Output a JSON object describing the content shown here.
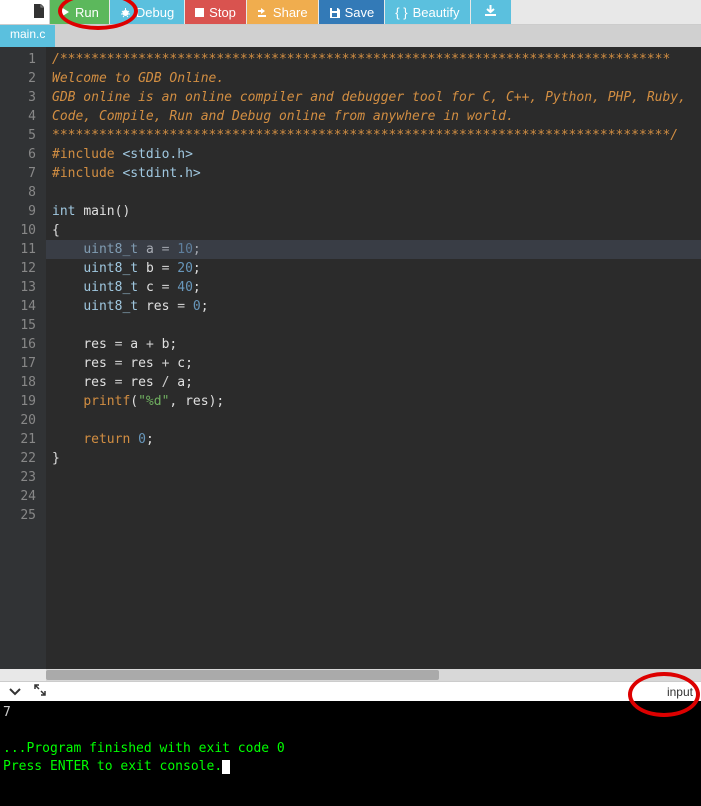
{
  "toolbar": {
    "run": "Run",
    "debug": "Debug",
    "stop": "Stop",
    "share": "Share",
    "save": "Save",
    "beautify": "Beautify"
  },
  "tabs": {
    "active": "main.c"
  },
  "code": {
    "lines": [
      {
        "n": 1,
        "t": "comment",
        "text": "/******************************************************************************"
      },
      {
        "n": 2,
        "t": "comment",
        "text": ""
      },
      {
        "n": 3,
        "t": "comment",
        "text": "Welcome to GDB Online."
      },
      {
        "n": 4,
        "t": "comment",
        "text": "GDB online is an online compiler and debugger tool for C, C++, Python, PHP, Ruby,"
      },
      {
        "n": 5,
        "t": "comment",
        "text": "Code, Compile, Run and Debug online from anywhere in world."
      },
      {
        "n": 6,
        "t": "comment",
        "text": ""
      },
      {
        "n": 7,
        "t": "comment",
        "text": "*******************************************************************************/"
      },
      {
        "n": 8,
        "t": "include",
        "kw": "#include",
        "arg": "<stdio.h>"
      },
      {
        "n": 9,
        "t": "include",
        "kw": "#include",
        "arg": "<stdint.h>"
      },
      {
        "n": 10,
        "t": "blank",
        "text": ""
      },
      {
        "n": 11,
        "t": "main",
        "kw": "int",
        "id": "main",
        "rest": "()"
      },
      {
        "n": 12,
        "t": "plain",
        "text": "{"
      },
      {
        "n": 13,
        "t": "decl",
        "ty": "uint8_t",
        "id": "a",
        "op": "=",
        "val": "10"
      },
      {
        "n": 14,
        "t": "decl",
        "ty": "uint8_t",
        "id": "b",
        "op": "=",
        "val": "20"
      },
      {
        "n": 15,
        "t": "decl",
        "ty": "uint8_t",
        "id": "c",
        "op": "=",
        "val": "40"
      },
      {
        "n": 16,
        "t": "decl",
        "ty": "uint8_t",
        "id": "res",
        "op": "=",
        "val": "0"
      },
      {
        "n": 17,
        "t": "blank",
        "text": ""
      },
      {
        "n": 18,
        "t": "assign",
        "lhs": "res",
        "op1": "=",
        "a": "a",
        "op2": "+",
        "b": "b"
      },
      {
        "n": 19,
        "t": "assign",
        "lhs": "res",
        "op1": "=",
        "a": "res",
        "op2": "+",
        "b": "c"
      },
      {
        "n": 20,
        "t": "assign",
        "lhs": "res",
        "op1": "=",
        "a": "res",
        "op2": "/",
        "b": "a"
      },
      {
        "n": 21,
        "t": "printf",
        "fn": "printf",
        "fmt": "\"%d\"",
        "arg": "res"
      },
      {
        "n": 22,
        "t": "blank",
        "text": ""
      },
      {
        "n": 23,
        "t": "return",
        "kw": "return",
        "val": "0"
      },
      {
        "n": 24,
        "t": "plain",
        "text": "}"
      },
      {
        "n": 25,
        "t": "blank",
        "text": ""
      }
    ]
  },
  "console": {
    "tab": "input",
    "output": "7",
    "finished": "...Program finished with exit code 0",
    "prompt": "Press ENTER to exit console."
  }
}
